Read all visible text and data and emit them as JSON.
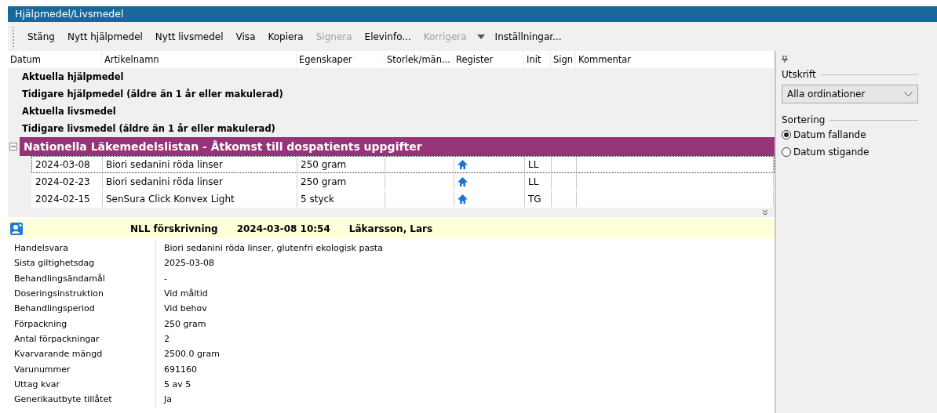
{
  "window": {
    "title": "Hjälpmedel/Livsmedel"
  },
  "toolbar": [
    {
      "label": "Stäng",
      "disabled": false,
      "dropdown": false
    },
    {
      "label": "Nytt hjälpmedel",
      "disabled": false,
      "dropdown": false
    },
    {
      "label": "Nytt livsmedel",
      "disabled": false,
      "dropdown": false
    },
    {
      "label": "Visa",
      "disabled": false,
      "dropdown": false
    },
    {
      "label": "Kopiera",
      "disabled": false,
      "dropdown": false
    },
    {
      "label": "Signera",
      "disabled": true,
      "dropdown": false
    },
    {
      "label": "Elevinfo...",
      "disabled": false,
      "dropdown": false
    },
    {
      "label": "Korrigera",
      "disabled": true,
      "dropdown": true
    },
    {
      "label": "Inställningar...",
      "disabled": false,
      "dropdown": false
    }
  ],
  "table": {
    "columns": [
      "Datum",
      "Artikelnamn",
      "Egenskaper",
      "Storlek/män...",
      "Register",
      "Init",
      "Sign",
      "Kommentar"
    ],
    "groups": [
      "Aktuella hjälpmedel",
      "Tidigare hjälpmedel (äldre än 1 år eller makulerad)",
      "Aktuella livsmedel",
      "Tidigare livsmedel (äldre än 1 år eller makulerad)"
    ],
    "section": {
      "title": "Nationella Läkemedelslistan - Åtkomst till dospatients uppgifter",
      "expanded": true,
      "rows": [
        {
          "date": "2024-03-08",
          "name": "Biori sedanini röda linser",
          "properties": "250 gram",
          "init": "LL",
          "selected": true
        },
        {
          "date": "2024-02-23",
          "name": "Biori sedanini röda linser",
          "properties": "250 gram",
          "init": "LL",
          "selected": false
        },
        {
          "date": "2024-02-15",
          "name": "SenSura Click Konvex Light",
          "properties": "5 styck",
          "init": "TG",
          "selected": false
        }
      ]
    }
  },
  "detail": {
    "type": "NLL förskrivning",
    "datetime": "2024-03-08 10:54",
    "prescriber": "Läkarsson, Lars",
    "fields": [
      {
        "label": "Handelsvara",
        "value": "Biori sedanini röda linser, glutenfri ekologisk pasta"
      },
      {
        "label": "Sista giltighetsdag",
        "value": "2025-03-08"
      },
      {
        "label": "Behandlingsändamål",
        "value": "-"
      },
      {
        "label": "Doseringsinstruktion",
        "value": "Vid måltid"
      },
      {
        "label": "Behandlingsperiod",
        "value": "Vid behov"
      },
      {
        "label": "Förpackning",
        "value": "250 gram"
      },
      {
        "label": "Antal förpackningar",
        "value": "2"
      },
      {
        "label": "Kvarvarande mängd",
        "value": "2500.0 gram"
      },
      {
        "label": "Varunummer",
        "value": "691160"
      },
      {
        "label": "Uttag kvar",
        "value": "5  av  5"
      },
      {
        "label": "Generikautbyte tillåtet",
        "value": "Ja"
      }
    ]
  },
  "side_panel": {
    "print_label": "Utskrift",
    "print_value": "Alla ordinationer",
    "sort_label": "Sortering",
    "sort_options": [
      {
        "label": "Datum fallande",
        "selected": true
      },
      {
        "label": "Datum stigande",
        "selected": false
      }
    ]
  }
}
